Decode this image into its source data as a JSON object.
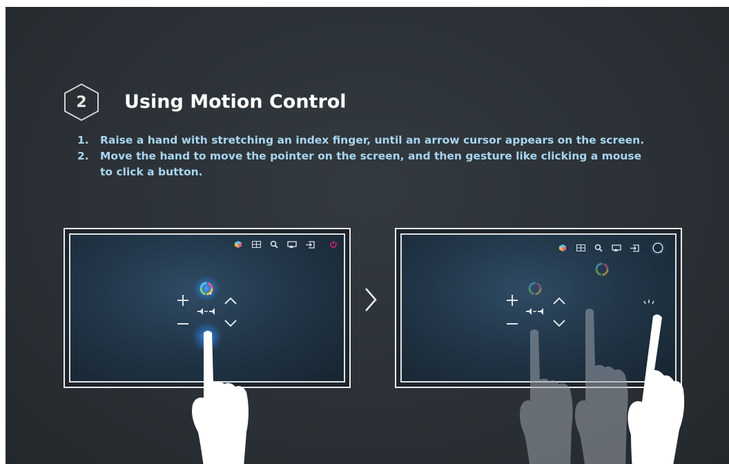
{
  "section": {
    "step_number": "2",
    "title": "Using Motion Control"
  },
  "instructions": [
    {
      "num": "1.",
      "text": "Raise a hand with stretching an index finger, until an arrow cursor appears on the screen."
    },
    {
      "num": "2.",
      "text": "Move the hand to move the pointer on the screen, and then gesture like clicking a mouse to click a button."
    }
  ],
  "icons": {
    "smart_hub": "smart-hub-icon",
    "apps": "apps-grid-icon",
    "search": "search-icon",
    "screen": "screen-mirror-icon",
    "source": "source-input-icon",
    "power": "power-icon",
    "volume_mute": "volume-mute-icon",
    "next": "chevron-right-icon"
  },
  "colors": {
    "background": "#2a3035",
    "instruction_text": "#a9d5f0",
    "power": "#e0206a",
    "cursor_glow": "#3fa2ff"
  }
}
